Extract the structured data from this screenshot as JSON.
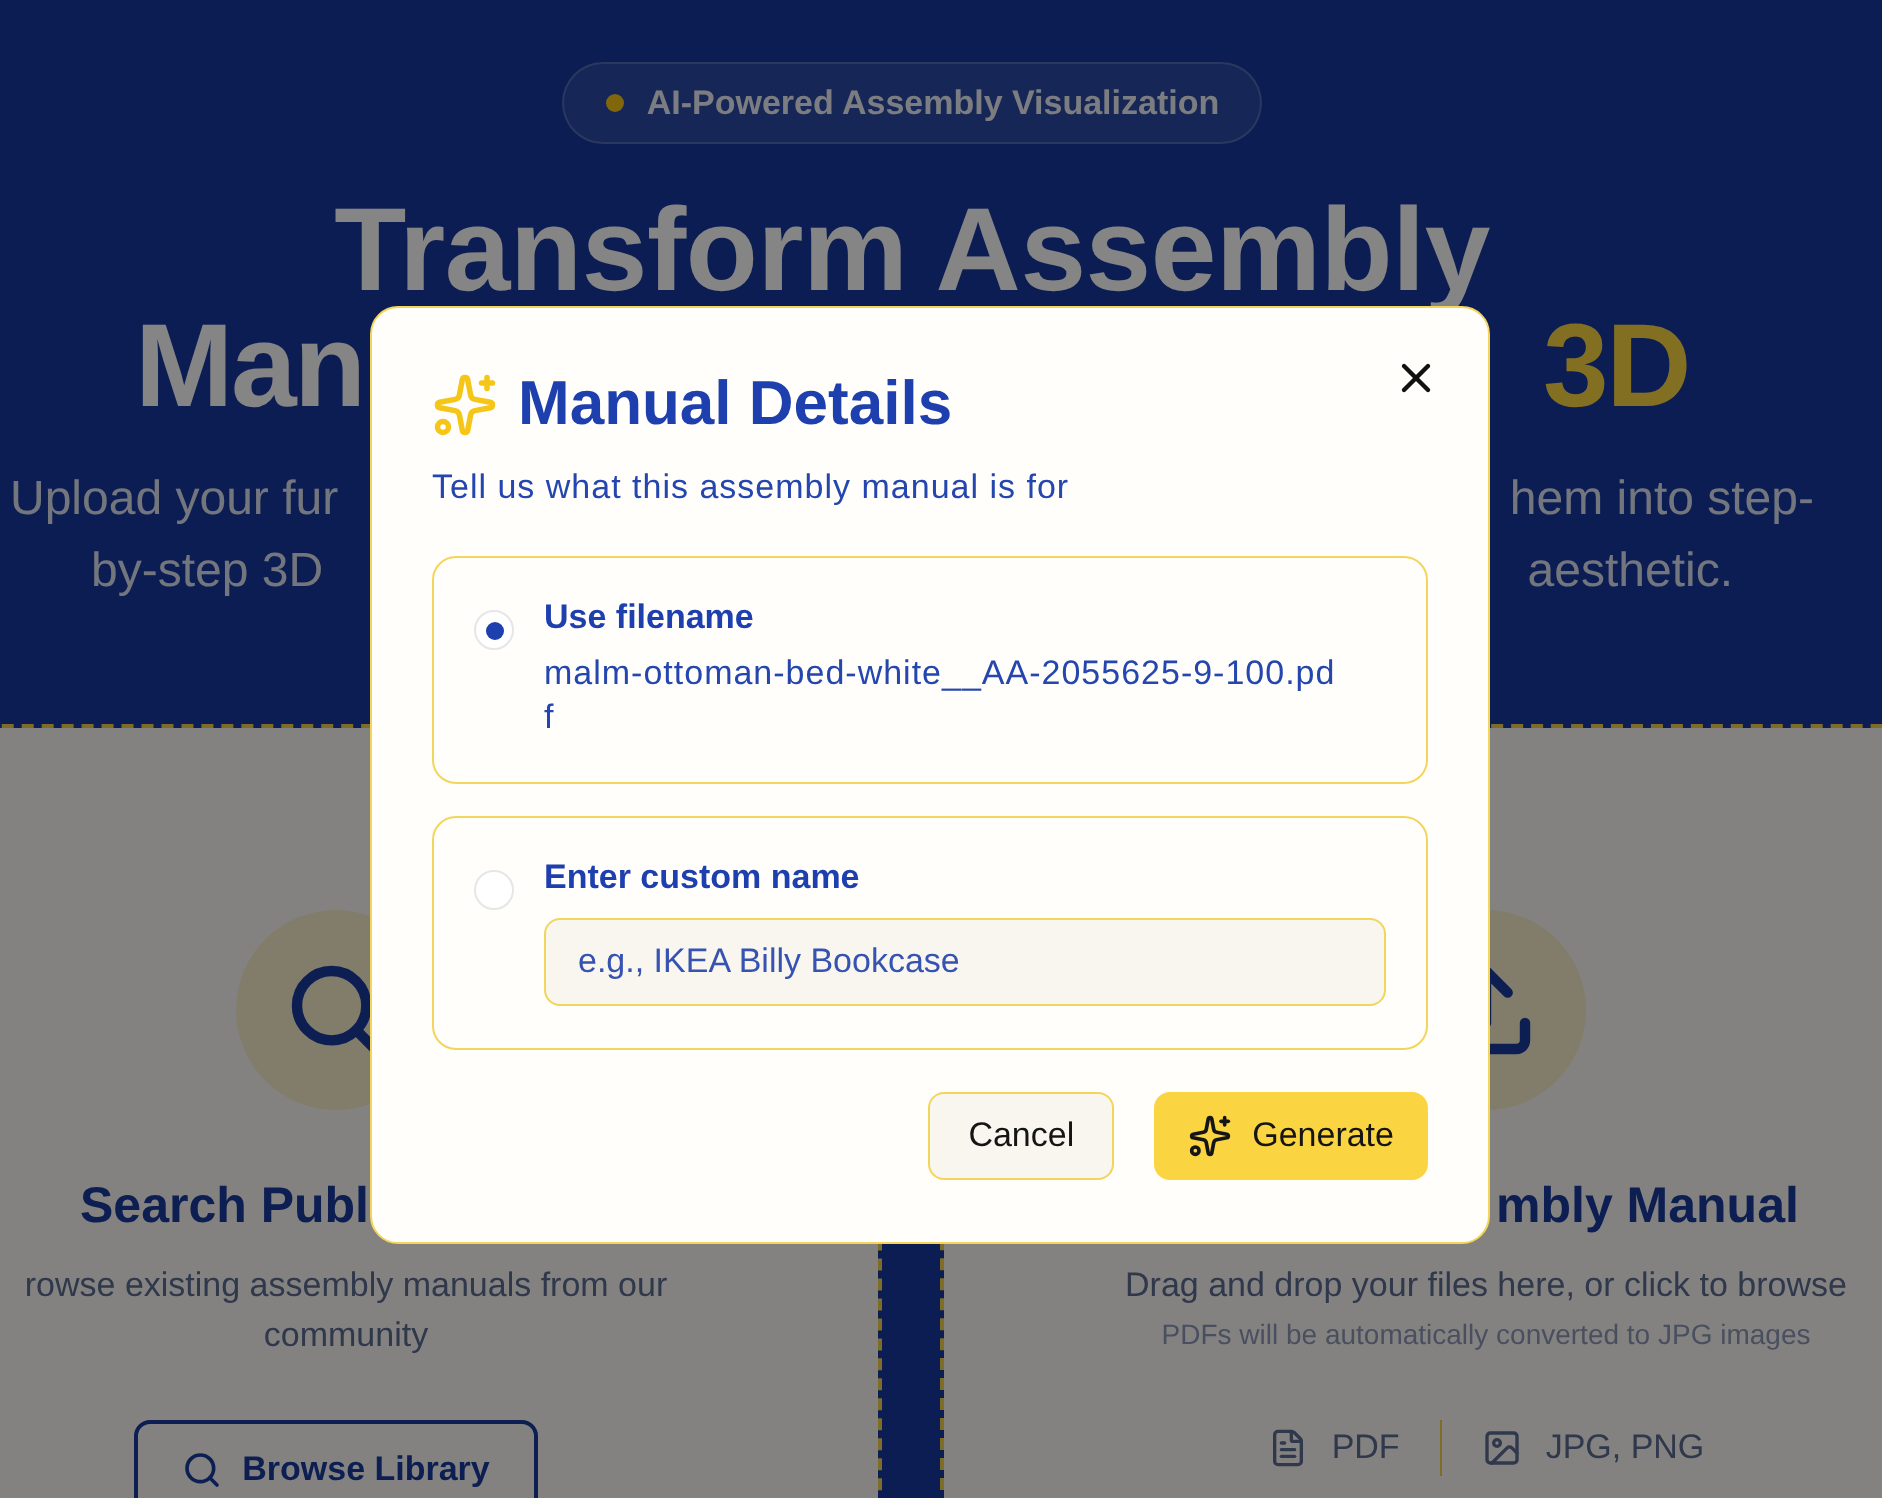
{
  "hero": {
    "badge": {
      "text": "AI-Powered Assembly Visualization"
    },
    "headline": {
      "line_1": "Transform Assembly",
      "line_2_left": [
        {
          "kind": "plain",
          "text": "Man"
        }
      ],
      "line_2_right": [
        {
          "kind": "accent",
          "text": "3D"
        }
      ]
    },
    "subtitle_lines": [
      {
        "left": "Upload your fur",
        "right": "hem into step-"
      },
      {
        "left": "by-step 3D",
        "right": "aesthetic."
      }
    ]
  },
  "cards": [
    {
      "kind": "search",
      "heading": "Search Publ",
      "description": "rowse existing assembly manuals from our community",
      "button": "Browse Library"
    },
    {
      "kind": "upload",
      "heading": "mbly Manual",
      "description": "Drag and drop your files here, or click to browse",
      "note": "PDFs will be automatically converted to JPG images",
      "formats": [
        {
          "kind": "document",
          "label": "PDF"
        },
        {
          "kind": "image",
          "label": "JPG, PNG"
        }
      ]
    }
  ],
  "modal": {
    "title": "Manual Details",
    "subtitle": "Tell us what this assembly manual is for",
    "options": [
      {
        "kind": "filename",
        "label": "Use filename",
        "value": "malm-ottoman-bed-white__AA-2055625-9-100.pdf",
        "selected": true
      },
      {
        "kind": "custom",
        "label": "Enter custom name",
        "placeholder": "e.g., IKEA Billy Bookcase",
        "selected": false
      }
    ],
    "buttons": [
      {
        "kind": "secondary",
        "label": "Cancel"
      },
      {
        "kind": "primary",
        "label": "Generate"
      }
    ]
  }
}
